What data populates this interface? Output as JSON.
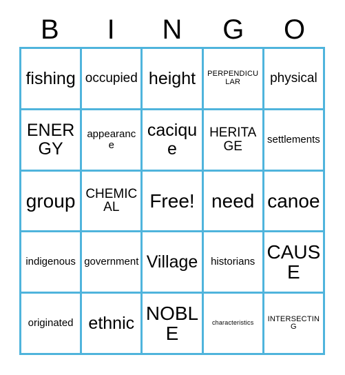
{
  "card": {
    "type": "bingo-card",
    "grid_color": "#4FB4DC",
    "background_color": "#ffffff",
    "text_color": "#000000",
    "columns": 5,
    "rows": 5
  },
  "header": {
    "letters": [
      "B",
      "I",
      "N",
      "G",
      "O"
    ]
  },
  "grid": {
    "rows": [
      {
        "cells": [
          {
            "text": "fishing"
          },
          {
            "text": "occupied"
          },
          {
            "text": "height"
          },
          {
            "text": "PERPENDICULAR"
          },
          {
            "text": "physical"
          }
        ]
      },
      {
        "cells": [
          {
            "text": "ENERGY"
          },
          {
            "text": "appearance"
          },
          {
            "text": "cacique"
          },
          {
            "text": "HERITAGE"
          },
          {
            "text": "settlements"
          }
        ]
      },
      {
        "cells": [
          {
            "text": "group"
          },
          {
            "text": "CHEMICAL"
          },
          {
            "text": "Free!"
          },
          {
            "text": "need"
          },
          {
            "text": "canoe"
          }
        ]
      },
      {
        "cells": [
          {
            "text": "indigenous"
          },
          {
            "text": "government"
          },
          {
            "text": "Village"
          },
          {
            "text": "historians"
          },
          {
            "text": "CAUSE"
          }
        ]
      },
      {
        "cells": [
          {
            "text": "originated"
          },
          {
            "text": "ethnic"
          },
          {
            "text": "NOBLE"
          },
          {
            "text": "characteristics"
          },
          {
            "text": "INTERSECTING"
          }
        ]
      }
    ]
  }
}
